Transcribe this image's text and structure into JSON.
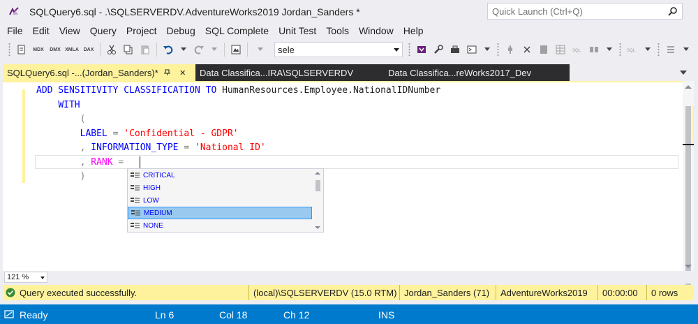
{
  "window": {
    "title": "SQLQuery6.sql - .\\SQLSERVERDV.AdventureWorks2019 Jordan_Sanders *",
    "quick_launch_placeholder": "Quick Launch (Ctrl+Q)"
  },
  "menu": [
    "File",
    "Edit",
    "View",
    "Query",
    "Project",
    "Debug",
    "SQL Complete",
    "Unit Test",
    "Tools",
    "Window",
    "Help"
  ],
  "toolbar": {
    "labels": [
      "MDX",
      "DMX",
      "XMLA",
      "DAX"
    ],
    "database_value": "sele"
  },
  "tabs": [
    {
      "label": "SQLQuery6.sql -...(Jordan_Sanders)*",
      "close": "✕",
      "active": true
    },
    {
      "label": "Data Classifica...IRA\\SQLSERVERDV",
      "active": false
    },
    {
      "label": "Data Classifica...reWorks2017_Dev",
      "active": false
    }
  ],
  "editor": {
    "lines": {
      "l1_kw": "ADD SENSITIVITY CLASSIFICATION TO ",
      "l1_obj": "HumanResources.Employee.NationalIDNumber",
      "l2_kw": "WITH",
      "l3": "(",
      "l4_kw": "LABEL",
      "l4_eq": " = ",
      "l4_str": "'Confidential - GDPR'",
      "l5_comma": ", ",
      "l5_kw": "INFORMATION_TYPE",
      "l5_eq": " = ",
      "l5_str": "'National ID'",
      "l6_comma": ", ",
      "l6_kw": "RANK",
      "l6_eq": " = ",
      "l7": ")"
    }
  },
  "completion": {
    "items": [
      "CRITICAL",
      "HIGH",
      "LOW",
      "MEDIUM",
      "NONE"
    ],
    "selected": "MEDIUM"
  },
  "zoom": "121 %",
  "query_status": {
    "message": "Query executed successfully.",
    "server": "(local)\\SQLSERVERDV (15.0 RTM)",
    "user": "Jordan_Sanders (71)",
    "database": "AdventureWorks2019",
    "elapsed": "00:00:00",
    "rows": "0 rows"
  },
  "statusbar": {
    "state": "Ready",
    "ln": "Ln 6",
    "col": "Col 18",
    "ch": "Ch 12",
    "mode": "INS"
  },
  "colors": {
    "accent_blue": "#007acc",
    "tab_yellow": "#fff29d",
    "keyword": "#0000ff",
    "string": "#ff0000",
    "function": "#ff00ff"
  }
}
